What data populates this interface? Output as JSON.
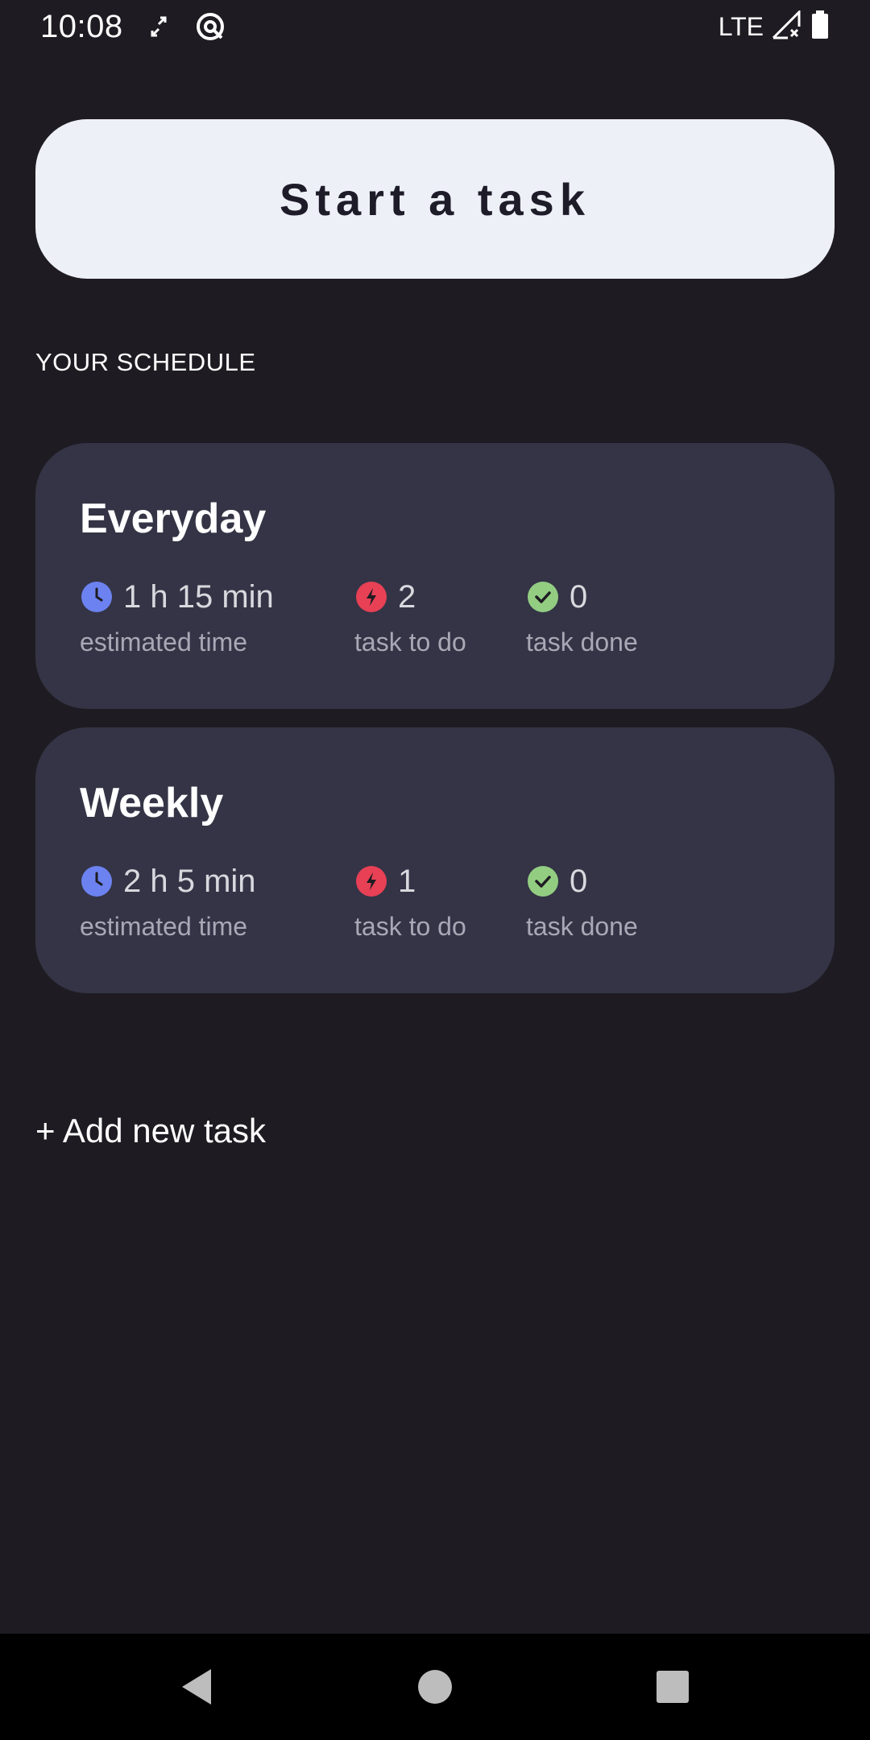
{
  "status_bar": {
    "time": "10:08",
    "network": "LTE",
    "icons": [
      "sync-icon",
      "data-saver-icon",
      "signal-icon",
      "battery-icon"
    ]
  },
  "start_button": {
    "label": "Start a task"
  },
  "schedule": {
    "title": "YOUR SCHEDULE",
    "cards": [
      {
        "title": "Everyday",
        "estimated_time": "1 h 15 min",
        "estimated_time_label": "estimated time",
        "tasks_to_do": "2",
        "tasks_to_do_label": "task to do",
        "tasks_done": "0",
        "tasks_done_label": "task done"
      },
      {
        "title": "Weekly",
        "estimated_time": "2 h 5 min",
        "estimated_time_label": "estimated time",
        "tasks_to_do": "1",
        "tasks_to_do_label": "task to do",
        "tasks_done": "0",
        "tasks_done_label": "task done"
      }
    ]
  },
  "add_task": {
    "label": "+ Add new task"
  },
  "colors": {
    "background": "#1e1c22",
    "card": "#343446",
    "button": "#eef0f8",
    "clock": "#6c82f0",
    "bolt": "#e84055",
    "check": "#93cd82"
  }
}
